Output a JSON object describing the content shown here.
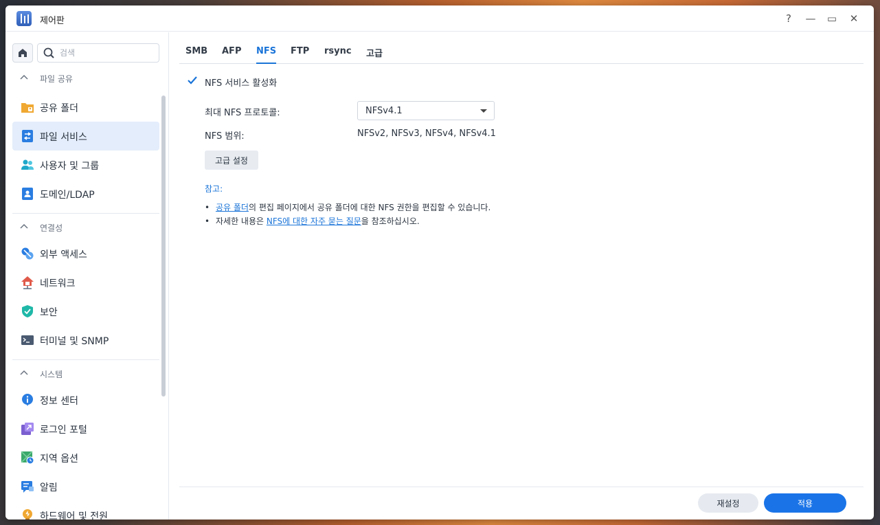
{
  "window": {
    "title": "제어판"
  },
  "titlebar": {
    "help": "?",
    "minimize": "—",
    "maximize": "▭",
    "close": "✕"
  },
  "sidebar": {
    "search_placeholder": "검색",
    "groups": [
      {
        "label": "파일 공유",
        "items": [
          {
            "label": "공유 폴더",
            "icon": "shared-folder-icon"
          },
          {
            "label": "파일 서비스",
            "icon": "file-services-icon",
            "active": true
          },
          {
            "label": "사용자 및 그룹",
            "icon": "user-group-icon"
          },
          {
            "label": "도메인/LDAP",
            "icon": "domain-ldap-icon"
          }
        ]
      },
      {
        "label": "연결성",
        "items": [
          {
            "label": "외부 액세스",
            "icon": "external-access-icon"
          },
          {
            "label": "네트워크",
            "icon": "network-icon"
          },
          {
            "label": "보안",
            "icon": "security-shield-icon"
          },
          {
            "label": "터미널 및 SNMP",
            "icon": "terminal-icon"
          }
        ]
      },
      {
        "label": "시스템",
        "items": [
          {
            "label": "정보 센터",
            "icon": "info-center-icon"
          },
          {
            "label": "로그인 포털",
            "icon": "login-portal-icon"
          },
          {
            "label": "지역 옵션",
            "icon": "regional-options-icon"
          },
          {
            "label": "알림",
            "icon": "notification-icon"
          },
          {
            "label": "하드웨어 및 전원",
            "icon": "hardware-power-icon"
          }
        ]
      }
    ]
  },
  "tabs": [
    {
      "label": "SMB"
    },
    {
      "label": "AFP"
    },
    {
      "label": "NFS",
      "active": true
    },
    {
      "label": "FTP"
    },
    {
      "label": "rsync"
    },
    {
      "label": "고급"
    }
  ],
  "nfs": {
    "enable_label": "NFS 서비스 활성화",
    "enabled": true,
    "max_protocol_label": "최대 NFS 프로토콜:",
    "max_protocol_value": "NFSv4.1",
    "range_label": "NFS 범위:",
    "range_value": "NFSv2, NFSv3, NFSv4, NFSv4.1",
    "advanced_button": "고급 설정"
  },
  "notes": {
    "title": "참고:",
    "line1_link": "공유 폴더",
    "line1_rest": "의 편집 페이지에서 공유 폴더에 대한 NFS 권한을 편집할 수 있습니다.",
    "line2_pre": "자세한 내용은 ",
    "line2_link": "NFS에 대한 자주 묻는 질문",
    "line2_post": "을 참조하십시오."
  },
  "footer": {
    "reset": "재설정",
    "apply": "적용"
  },
  "colors": {
    "accent": "#1a74e8",
    "active_bg": "#e3edfb"
  }
}
